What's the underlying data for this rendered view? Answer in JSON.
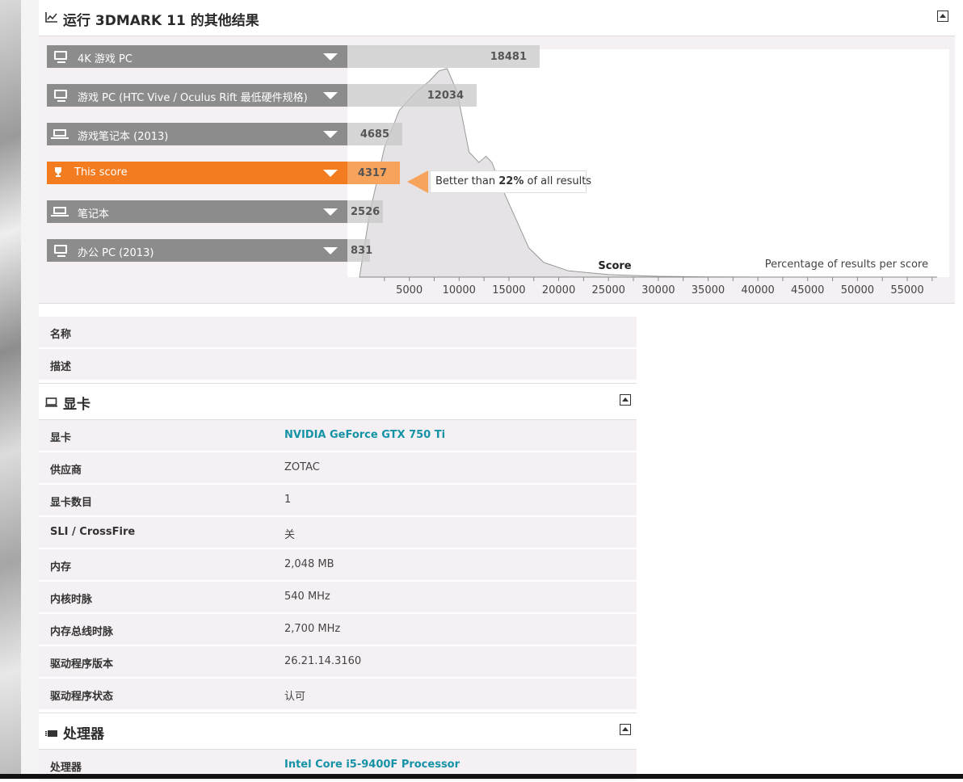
{
  "results_section": {
    "title": "运行 3DMARK 11 的其他结果",
    "icon": "line-chart-icon",
    "bars": [
      {
        "label": "4K 游戏 PC",
        "value": "18481",
        "icon": "desktop-icon"
      },
      {
        "label": "游戏 PC (HTC Vive / Oculus Rift 最低硬件规格)",
        "value": "12034",
        "icon": "desktop-icon"
      },
      {
        "label": "游戏笔记本 (2013)",
        "value": "4685",
        "icon": "laptop-icon"
      },
      {
        "label": "This score",
        "value": "4317",
        "icon": "trophy-icon"
      },
      {
        "label": "笔记本",
        "value": "2526",
        "icon": "laptop-icon"
      },
      {
        "label": "办公 PC (2013)",
        "value": "831",
        "icon": "desktop-icon"
      }
    ],
    "callout": {
      "prefix": "Better than ",
      "percent": "22%",
      "suffix": " of all results"
    },
    "highlight_color": "#f47c20"
  },
  "chart_data": {
    "type": "area",
    "xlabel": "Score",
    "ylabel": "Percentage of results per score",
    "x_ticks": [
      "5000",
      "10000",
      "15000",
      "20000",
      "25000",
      "30000",
      "35000",
      "40000",
      "45000",
      "50000",
      "55000"
    ],
    "xlim": [
      0,
      58000
    ],
    "x": [
      0,
      1000,
      2500,
      4000,
      5500,
      7000,
      8000,
      8800,
      9800,
      11000,
      12000,
      12700,
      13300,
      14000,
      15500,
      17000,
      18500,
      21000,
      25000,
      30000,
      35000,
      40000
    ],
    "y": [
      0,
      30,
      62,
      80,
      88,
      94,
      99,
      100,
      89,
      60,
      55,
      58,
      55,
      46,
      30,
      14,
      7,
      3,
      1.2,
      0.4,
      0.1,
      0
    ]
  },
  "info_rows": [
    {
      "key": "名称",
      "value": ""
    },
    {
      "key": "描述",
      "value": ""
    }
  ],
  "gpu_section": {
    "title": "显卡",
    "icon": "monitor-icon",
    "rows": [
      {
        "key": "显卡",
        "value": "NVIDIA GeForce GTX 750 Ti",
        "link": true
      },
      {
        "key": "供应商",
        "value": "ZOTAC"
      },
      {
        "key": "显卡数目",
        "value": "1"
      },
      {
        "key": "SLI / CrossFire",
        "value": "关"
      },
      {
        "key": "内存",
        "value": "2,048 MB"
      },
      {
        "key": "内核时脉",
        "value": "540 MHz"
      },
      {
        "key": "内存总线时脉",
        "value": "2,700 MHz"
      },
      {
        "key": "驱动程序版本",
        "value": "26.21.14.3160"
      },
      {
        "key": "驱动程序状态",
        "value": "认可"
      }
    ]
  },
  "cpu_section": {
    "title": "处理器",
    "icon": "cpu-chip-icon",
    "rows": [
      {
        "key": "处理器",
        "value": "Intel Core i5-9400F Processor",
        "link": true
      }
    ]
  }
}
